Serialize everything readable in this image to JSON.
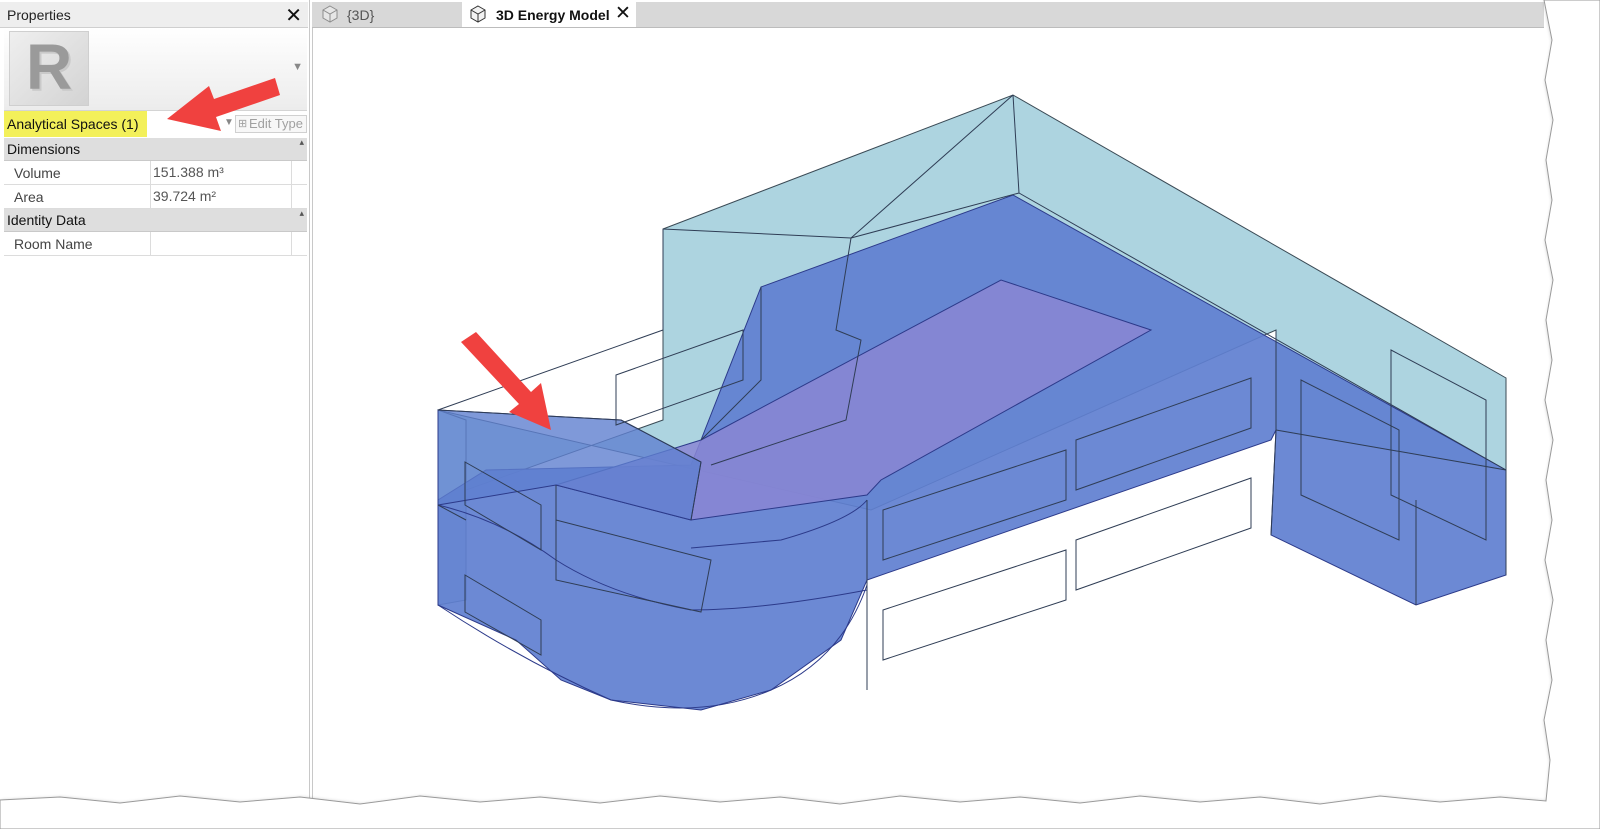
{
  "properties": {
    "title": "Properties",
    "filter_label": "Analytical Spaces (1)",
    "edit_type_label": "Edit Type",
    "groups": [
      {
        "label": "Dimensions",
        "rows": [
          {
            "name": "Volume",
            "value": "151.388 m³"
          },
          {
            "name": "Area",
            "value": "39.724 m²"
          }
        ]
      },
      {
        "label": "Identity Data",
        "rows": [
          {
            "name": "Room Name",
            "value": ""
          }
        ]
      }
    ]
  },
  "tabs": [
    {
      "label": "{3D}",
      "active": false
    },
    {
      "label": "3D Energy Model",
      "active": true
    }
  ],
  "icons": {
    "close": "close-icon",
    "revit_logo": "revit-logo-icon",
    "view_cube": "view-cube-icon"
  },
  "colors": {
    "highlight": "#f3f05a",
    "annotation_arrow": "#f0413f",
    "space_fill": "#5a78c8",
    "space_fill_pink": "#9a86d6",
    "envelope_fill": "#a9d2de"
  }
}
